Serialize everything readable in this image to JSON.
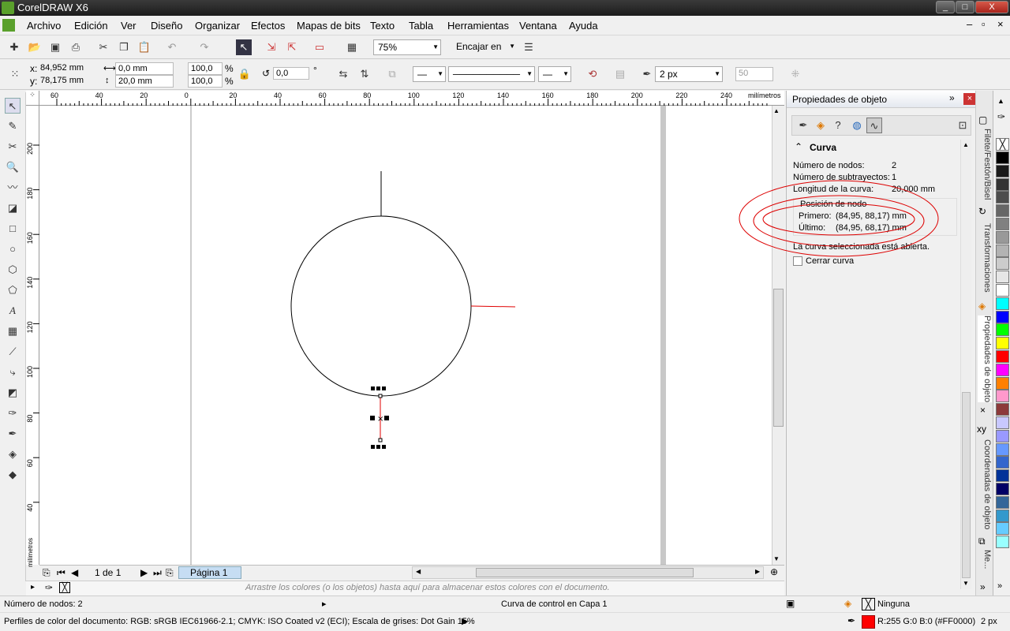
{
  "window": {
    "title": "CorelDRAW X6",
    "min": "_",
    "max": "□",
    "close": "X"
  },
  "menubar": [
    "Archivo",
    "Edición",
    "Ver",
    "Diseño",
    "Organizar",
    "Efectos",
    "Mapas de bits",
    "Texto",
    "Tabla",
    "Herramientas",
    "Ventana",
    "Ayuda"
  ],
  "standard_toolbar": {
    "zoom": "75%",
    "snap": "Encajar en"
  },
  "property_bar": {
    "x_label": "x:",
    "x_value": "84,952 mm",
    "y_label": "y:",
    "y_value": "78,175 mm",
    "w_value": "0,0 mm",
    "h_value": "20,0 mm",
    "scale_x": "100,0",
    "scale_y": "100,0",
    "percent": "%",
    "angle": "0,0",
    "degree": "°",
    "outline_width": "2 px",
    "miter": "50"
  },
  "ruler": {
    "units": "milímetros",
    "h_ticks": [
      "60",
      "40",
      "20",
      "0",
      "20",
      "40",
      "60",
      "80",
      "100",
      "120",
      "140",
      "160",
      "180",
      "200",
      "220",
      "240"
    ],
    "v_ticks": [
      "200",
      "180",
      "160",
      "140",
      "120",
      "100",
      "80",
      "60",
      "40"
    ]
  },
  "page_nav": {
    "counter": "1 de 1",
    "tab": "Página 1"
  },
  "color_dock_hint": "Arrastre los colores (o los objetos) hasta aquí para almacenar estos colores con el documento.",
  "docker": {
    "title": "Propiedades de objeto",
    "section": "Curva",
    "rows": [
      {
        "label": "Número de nodos:",
        "value": "2"
      },
      {
        "label": "Número de subtrayectos:",
        "value": "1"
      },
      {
        "label": "Longitud de la curva:",
        "value": "20,000 mm"
      }
    ],
    "node_group_title": "Posición de nodo",
    "first_label": "Primero:",
    "first_value": "(84,95, 88,17) mm",
    "last_label": "Último:",
    "last_value": "(84,95, 68,17) mm",
    "open_note": "La curva seleccionada está abierta.",
    "close_curve": "Cerrar curva"
  },
  "docker_tabs": [
    "Filete/Festón/Bisel",
    "Transformaciones",
    "Propiedades de objeto",
    "Coordenadas de objeto",
    "Me..."
  ],
  "palette_colors": [
    "#000000",
    "#1a1a1a",
    "#333333",
    "#4d4d4d",
    "#666666",
    "#808080",
    "#999999",
    "#b3b3b3",
    "#cccccc",
    "#e6e6e6",
    "#ffffff",
    "#00ffff",
    "#0000ff",
    "#00ff00",
    "#ffff00",
    "#ff0000",
    "#ff00ff",
    "#ff8000",
    "#ff99cc",
    "#8c3a3a",
    "#c8c8ff",
    "#9999ff",
    "#6699ff",
    "#3366cc",
    "#003399",
    "#000066",
    "#336699",
    "#3399cc",
    "#66ccff",
    "#99ffff"
  ],
  "status": {
    "nodes": "Número de nodos: 2",
    "layer": "Curva de control en Capa 1",
    "fill": "Ninguna",
    "outline_color": "R:255 G:0 B:0 (#FF0000)",
    "outline_width": "2 px",
    "color_profile": "Perfiles de color del documento: RGB: sRGB IEC61966-2.1; CMYK: ISO Coated v2 (ECI); Escala de grises: Dot Gain 15%",
    "outline_hex": "#FF0000"
  }
}
